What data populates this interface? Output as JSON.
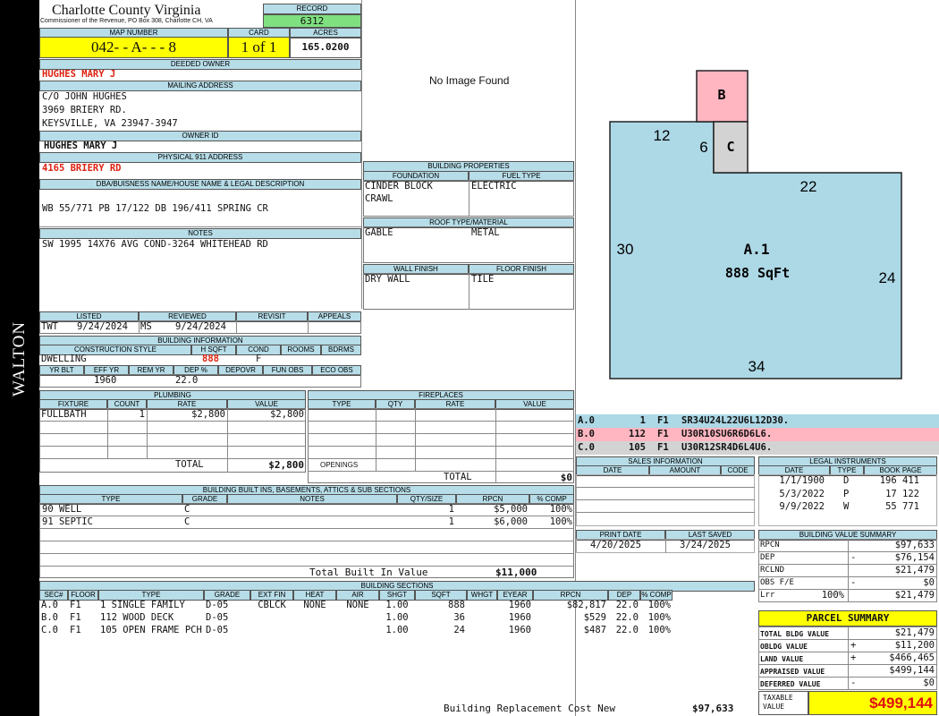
{
  "sidebar": {
    "label": "WALTON"
  },
  "header": {
    "county": "Charlotte County Virginia",
    "subtitle": "Commissioner of the Revenue, PO Box 308, Charlotte CH, VA",
    "record_label": "RECORD",
    "record": "6312"
  },
  "map": {
    "map_label": "MAP NUMBER",
    "map_number": "042- - A- - - 8",
    "card_label": "CARD",
    "card": "1 of 1",
    "acres_label": "ACRES",
    "acres": "165.0200"
  },
  "owner": {
    "deeded_label": "DEEDED OWNER",
    "deeded": "HUGHES MARY J",
    "mailing_label": "MAILING ADDRESS",
    "mailing": [
      "C/O JOHN HUGHES",
      "3969 BRIERY RD.",
      "KEYSVILLE, VA 23947-3947"
    ],
    "owner_id_label": "OWNER ID",
    "owner_id": "HUGHES MARY J",
    "physical_label": "PHYSICAL 911 ADDRESS",
    "physical": "4165 BRIERY RD",
    "dba_label": "DBA/BUISNESS NAME/HOUSE NAME & LEGAL DESCRIPTION",
    "dba": "WB 55/771 PB 17/122 DB 196/411 SPRING CR",
    "notes_label": "NOTES",
    "notes": "SW 1995 14X76 AVG COND-3264 WHITEHEAD RD"
  },
  "image": {
    "text": "No Image Found"
  },
  "props": {
    "title": "BUILDING PROPERTIES",
    "foundation_label": "FOUNDATION",
    "fuel_label": "FUEL TYPE",
    "foundation": [
      "CINDER BLOCK",
      "CRAWL"
    ],
    "fuel": "ELECTRIC",
    "roof_label": "ROOF TYPE/MATERIAL",
    "roof_type": "GABLE",
    "roof_material": "METAL",
    "wall_label": "WALL FINISH",
    "floor_label": "FLOOR FINISH",
    "wall": "DRY WALL",
    "floor": "TILE"
  },
  "listing": {
    "listed_label": "LISTED",
    "reviewed_label": "REVIEWED",
    "revisit_label": "REVISIT",
    "appeals_label": "APPEALS",
    "listed_by": "TWT",
    "listed_date": "9/24/2024",
    "reviewed_by": "MS",
    "reviewed_date": "9/24/2024"
  },
  "bldg_info": {
    "title": "BUILDING INFORMATION",
    "cols": [
      "CONSTRUCTION STYLE",
      "H SQFT",
      "COND",
      "ROOMS",
      "BDRMS"
    ],
    "style": "DWELLING",
    "hsqft": "888",
    "cond": "F",
    "cols2": [
      "YR BLT",
      "EFF YR",
      "REM YR",
      "DEP %",
      "DEPOVR",
      "FUN OBS",
      "ECO OBS"
    ],
    "eff_yr": "1960",
    "dep": "22.0"
  },
  "plumbing": {
    "title": "PLUMBING",
    "cols": [
      "FIXTURE",
      "COUNT",
      "RATE",
      "VALUE"
    ],
    "rows": [
      {
        "fixture": "FULLBATH",
        "count": "1",
        "rate": "$2,800",
        "value": "$2,800"
      }
    ],
    "total_label": "TOTAL",
    "total": "$2,800"
  },
  "fireplaces": {
    "title": "FIREPLACES",
    "cols": [
      "TYPE",
      "QTY",
      "RATE",
      "VALUE"
    ],
    "openings_label": "OPENINGS",
    "total_label": "TOTAL",
    "total": "$0"
  },
  "builtins": {
    "title": "BUILDING BUILT INS, BASEMENTS, ATTICS & SUB SECTIONS",
    "cols": [
      "TYPE",
      "GRADE",
      "NOTES",
      "QTY/SIZE",
      "RPCN",
      "% COMP"
    ],
    "rows": [
      {
        "type": "90 WELL",
        "grade": "C",
        "qty": "1",
        "rpcn": "$5,000",
        "comp": "100%"
      },
      {
        "type": "91 SEPTIC",
        "grade": "C",
        "qty": "1",
        "rpcn": "$6,000",
        "comp": "100%"
      }
    ],
    "total_label": "Total Built In Value",
    "total": "$11,000"
  },
  "sections": {
    "title": "BUILDING SECTIONS",
    "cols": [
      "SEC#",
      "FLOOR",
      "TYPE",
      "GRADE",
      "EXT FIN",
      "HEAT",
      "AIR",
      "SHGT",
      "SQFT",
      "WHGT",
      "EYEAR",
      "RPCN",
      "DEP",
      "% COMP"
    ],
    "rows": [
      {
        "sec": "A.0",
        "floor": "F1",
        "type": "1 SINGLE FAMILY",
        "grade": "D-05",
        "ext": "CBLCK",
        "heat": "NONE",
        "air": "NONE",
        "shgt": "1.00",
        "sqft": "888",
        "eyear": "1960",
        "rpcn": "$82,817",
        "dep": "22.0",
        "comp": "100%"
      },
      {
        "sec": "B.0",
        "floor": "F1",
        "type": "112 WOOD DECK",
        "grade": "D-05",
        "ext": "",
        "heat": "",
        "air": "",
        "shgt": "1.00",
        "sqft": "36",
        "eyear": "1960",
        "rpcn": "$529",
        "dep": "22.0",
        "comp": "100%"
      },
      {
        "sec": "C.0",
        "floor": "F1",
        "type": "105 OPEN FRAME PCH",
        "grade": "D-05",
        "ext": "",
        "heat": "",
        "air": "",
        "shgt": "1.00",
        "sqft": "24",
        "eyear": "1960",
        "rpcn": "$487",
        "dep": "22.0",
        "comp": "100%"
      }
    ],
    "replacement_label": "Building Replacement Cost New",
    "replacement": "$97,633"
  },
  "sketch": {
    "labels": {
      "b": "B",
      "c": "C",
      "a1": "A.1",
      "sqft": "888 SqFt",
      "d12": "12",
      "d6": "6",
      "d22": "22",
      "d30": "30",
      "d24": "24",
      "d34": "34"
    },
    "fill_main": "#add8e6",
    "fill_b": "#ffb6c1",
    "fill_c": "#d3d3d3"
  },
  "sketch_legend": [
    {
      "sec": "A.0",
      "area": "1",
      "floor": "F1",
      "code": "SR34U24L22U6L12D30.",
      "color": "#add8e6"
    },
    {
      "sec": "B.0",
      "area": "112",
      "floor": "F1",
      "code": "U30R10SU6R6D6L6.",
      "color": "#ffb6c1"
    },
    {
      "sec": "C.0",
      "area": "105",
      "floor": "F1",
      "code": "U30R12SR4D6L4U6.",
      "color": "#d3d3d3"
    }
  ],
  "sales": {
    "title": "SALES INFORMATION",
    "cols": [
      "DATE",
      "AMOUNT",
      "CODE"
    ]
  },
  "legal": {
    "title": "LEGAL INSTRUMENTS",
    "cols": [
      "DATE",
      "TYPE",
      "BOOK PAGE"
    ],
    "rows": [
      {
        "date": "1/1/1900",
        "type": "D",
        "book": "196 411"
      },
      {
        "date": "5/3/2022",
        "type": "P",
        "book": "17 122"
      },
      {
        "date": "9/9/2022",
        "type": "W",
        "book": "55 771"
      }
    ]
  },
  "print": {
    "print_label": "PRINT DATE",
    "print_date": "4/20/2025",
    "saved_label": "LAST SAVED",
    "saved_date": "3/24/2025"
  },
  "bvs": {
    "title": "BUILDING VALUE SUMMARY",
    "rows": [
      {
        "label": "RPCN",
        "sign": "",
        "value": "$97,633"
      },
      {
        "label": "DEP",
        "sign": "-",
        "value": "$76,154"
      },
      {
        "label": "RCLND",
        "sign": "",
        "value": "$21,479"
      },
      {
        "label": "OBS F/E",
        "sign": "-",
        "value": "$0"
      },
      {
        "label": "Lrr",
        "pct": "100%",
        "sign": "",
        "value": "$21,479"
      }
    ]
  },
  "parcel": {
    "title": "PARCEL SUMMARY",
    "rows": [
      {
        "label": "TOTAL BLDG VALUE",
        "sign": "",
        "value": "$21,479"
      },
      {
        "label": "OBLDG VALUE",
        "sign": "+",
        "value": "$11,200"
      },
      {
        "label": "LAND VALUE",
        "sign": "+",
        "value": "$466,465"
      },
      {
        "label": "APPRAISED VALUE",
        "sign": "",
        "value": "$499,144"
      },
      {
        "label": "DEFERRED VALUE",
        "sign": "-",
        "value": "$0"
      }
    ],
    "taxable_label": "TAXABLE VALUE",
    "taxable": "$499,144"
  }
}
